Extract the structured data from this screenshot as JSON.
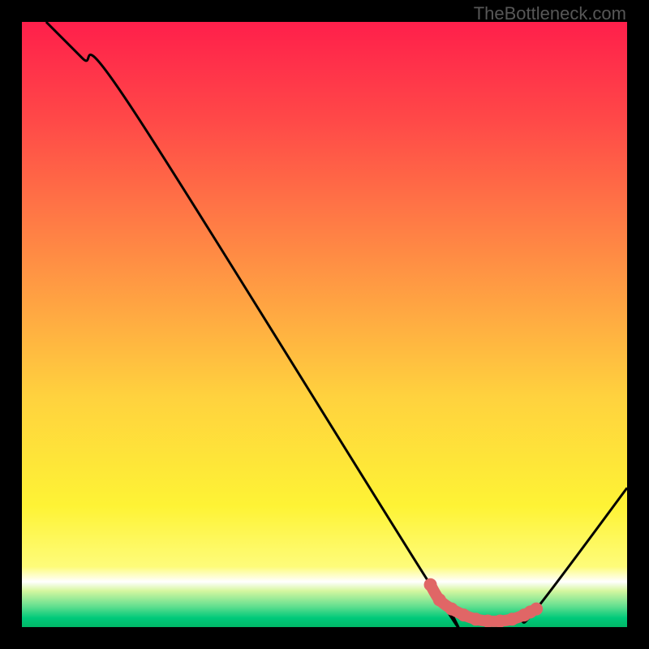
{
  "watermark": "TheBottleneck.com",
  "chart_data": {
    "type": "line",
    "title": "",
    "xlabel": "",
    "ylabel": "",
    "xlim": [
      0,
      100
    ],
    "ylim": [
      0,
      100
    ],
    "grid": false,
    "legend": false,
    "series": [
      {
        "name": "curve",
        "color": "#000000",
        "x": [
          4,
          10,
          18,
          67.5,
          71,
          76,
          82,
          85,
          100
        ],
        "y": [
          100,
          94,
          86,
          7,
          3,
          1,
          1,
          3,
          23
        ]
      },
      {
        "name": "highlight-dots",
        "color": "#e06666",
        "x": [
          67.5,
          69,
          71,
          73,
          75,
          77,
          79,
          81,
          83,
          84,
          85
        ],
        "y": [
          7,
          4.5,
          3,
          2,
          1.3,
          1,
          1,
          1.3,
          2,
          2.5,
          3
        ]
      }
    ],
    "background_gradient": {
      "type": "vertical",
      "stops": [
        {
          "pos": 0.0,
          "color": "#ff1f4b"
        },
        {
          "pos": 0.16,
          "color": "#ff4848"
        },
        {
          "pos": 0.4,
          "color": "#ff9044"
        },
        {
          "pos": 0.62,
          "color": "#ffd23e"
        },
        {
          "pos": 0.8,
          "color": "#fef335"
        },
        {
          "pos": 0.9,
          "color": "#fefc7a"
        },
        {
          "pos": 0.925,
          "color": "#ffffff"
        },
        {
          "pos": 0.94,
          "color": "#d6f7a0"
        },
        {
          "pos": 0.965,
          "color": "#66e090"
        },
        {
          "pos": 0.985,
          "color": "#00c97a"
        },
        {
          "pos": 1.0,
          "color": "#00b867"
        }
      ]
    }
  }
}
